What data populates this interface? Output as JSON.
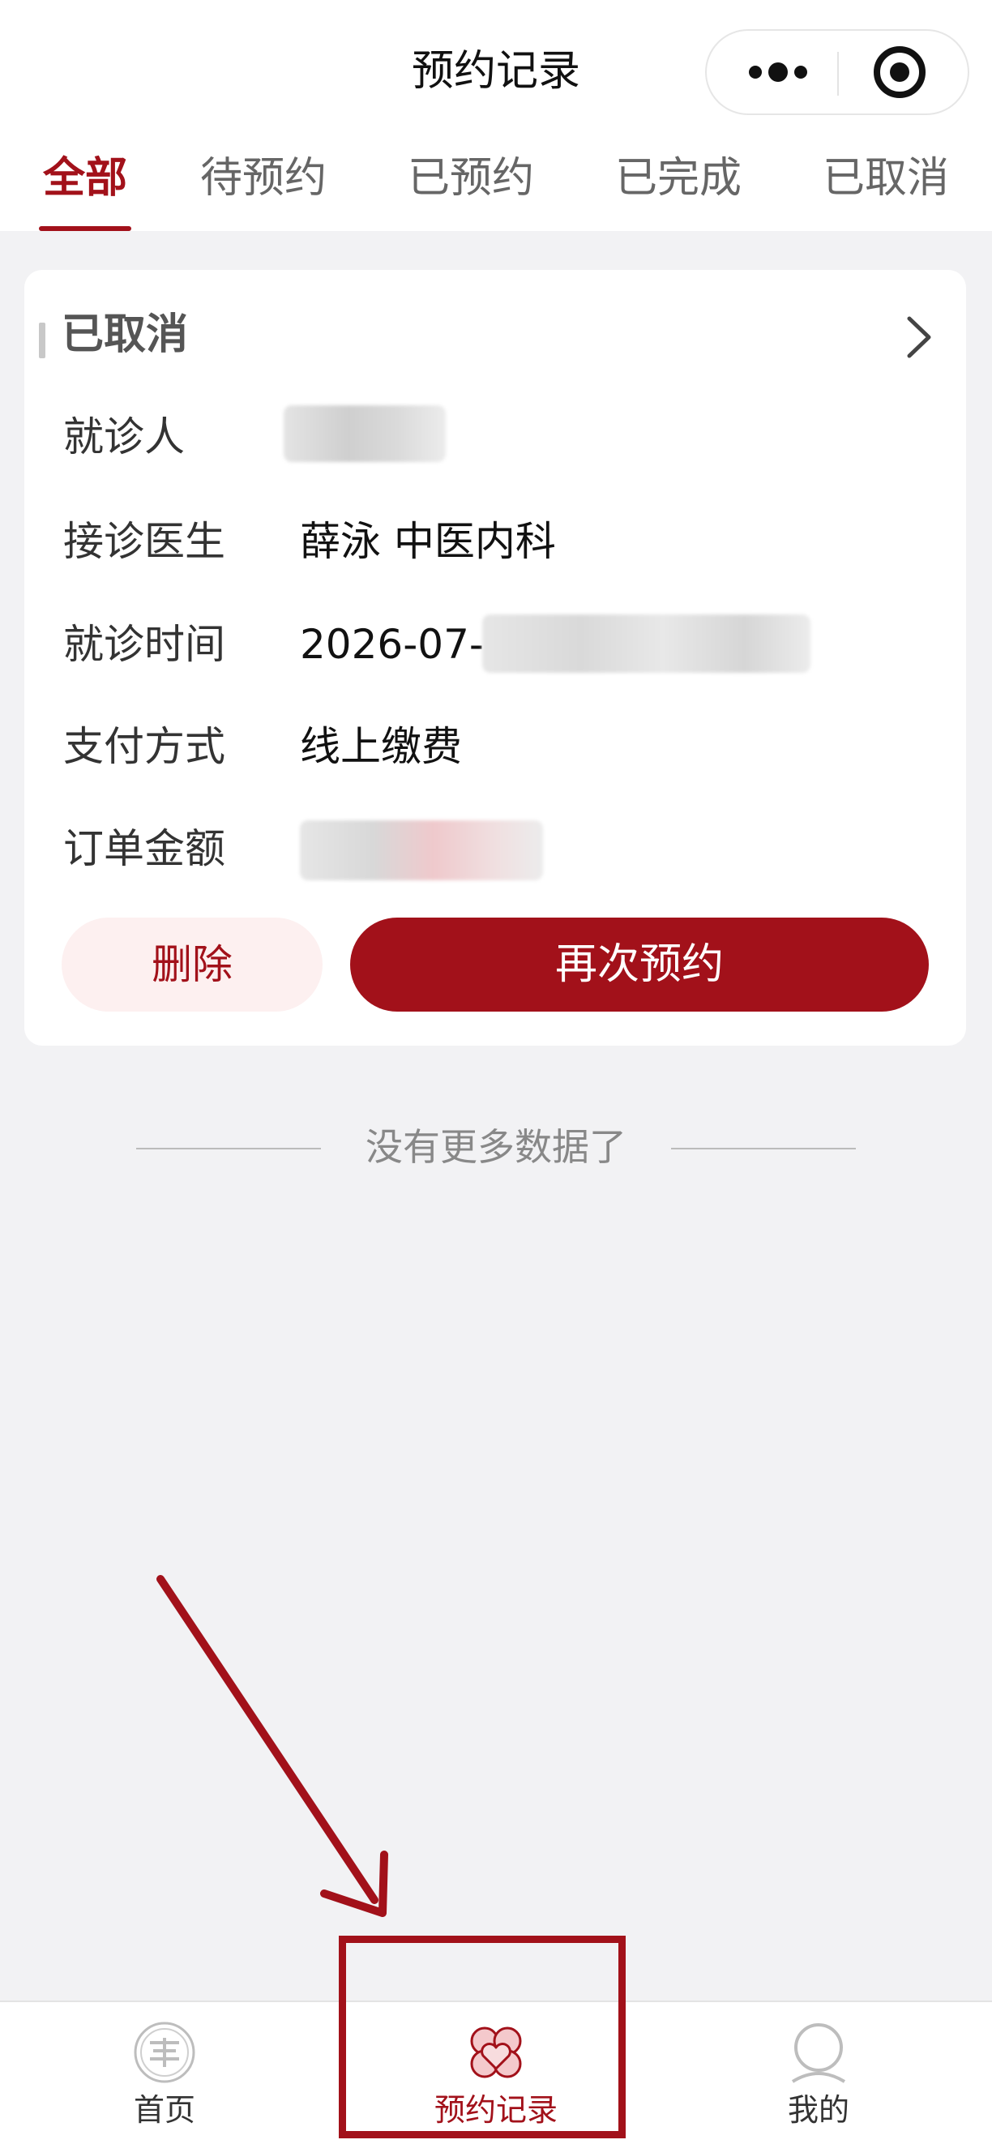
{
  "header": {
    "title": "预约记录"
  },
  "capsule": {
    "more_icon": "more-dots-icon",
    "close_icon": "target-close-icon"
  },
  "tabs": [
    {
      "label": "全部",
      "active": true
    },
    {
      "label": "待预约",
      "active": false
    },
    {
      "label": "已预约",
      "active": false
    },
    {
      "label": "已完成",
      "active": false
    },
    {
      "label": "已取消",
      "active": false
    }
  ],
  "card": {
    "status": "已取消",
    "rows": [
      {
        "label": "就诊人",
        "value": ""
      },
      {
        "label": "接诊医生",
        "value": "薛泳 中医内科"
      },
      {
        "label": "就诊时间",
        "value": "2026-07-"
      },
      {
        "label": "支付方式",
        "value": "线上缴费"
      },
      {
        "label": "订单金额",
        "value": ""
      }
    ],
    "delete_label": "删除",
    "rebook_label": "再次预约"
  },
  "list_footer": "没有更多数据了",
  "bottom_nav": [
    {
      "label": "首页",
      "icon": "home-seal-icon",
      "active": false
    },
    {
      "label": "预约记录",
      "icon": "heart-clover-icon",
      "active": true
    },
    {
      "label": "我的",
      "icon": "user-icon",
      "active": false
    }
  ],
  "colors": {
    "brand": "#a2111a",
    "background": "#f2f2f4",
    "delete_bg": "#fdf0f0"
  }
}
